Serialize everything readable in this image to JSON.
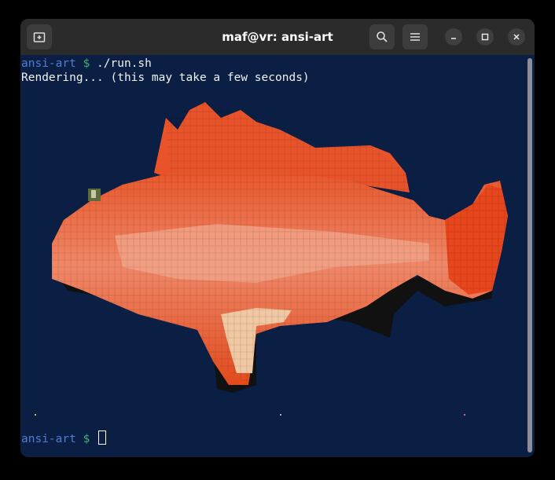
{
  "window": {
    "title": "maf@vr: ansi-art"
  },
  "titlebar": {
    "new_tab_icon": "new-tab-icon",
    "search_icon": "search-icon",
    "menu_icon": "hamburger-menu-icon",
    "minimize_icon": "minimize-icon",
    "maximize_icon": "maximize-icon",
    "close_icon": "close-icon"
  },
  "terminal": {
    "prompt": "ansi-art",
    "dollar": "$",
    "command": " ./run.sh",
    "output": "Rendering... (this may take a few seconds)",
    "colors": {
      "background": "#0b1e44",
      "prompt": "#4d7fd6",
      "dollar": "#3fb56f"
    }
  },
  "art": {
    "subject": "orange fish rendered as ANSI block art"
  }
}
